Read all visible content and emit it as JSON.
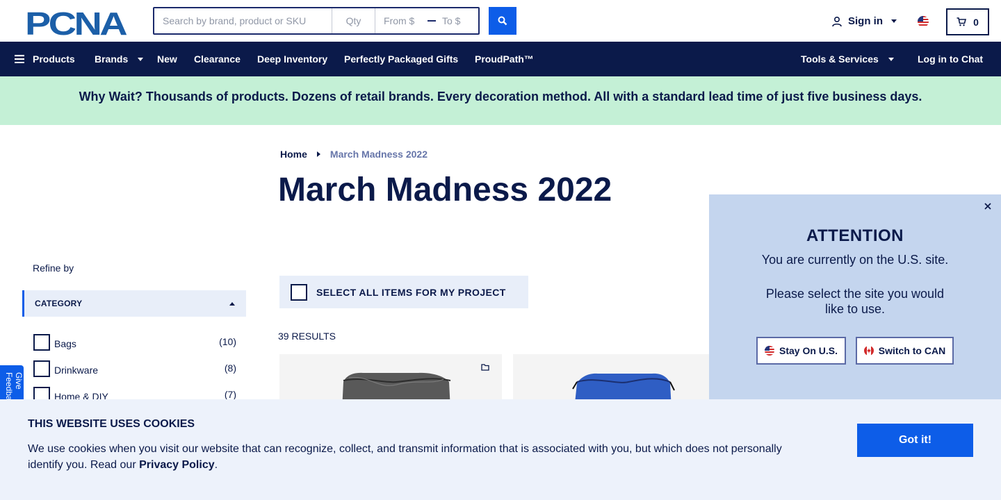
{
  "header": {
    "logo_text": "PCNA",
    "search_placeholder": "Search by brand, product or SKU",
    "qty_placeholder": "Qty",
    "from_placeholder": "From $",
    "to_placeholder": "To $",
    "signin_label": "Sign in",
    "cart_count": "0"
  },
  "nav": {
    "products": "Products",
    "brands": "Brands",
    "new": "New",
    "clearance": "Clearance",
    "deep_inventory": "Deep Inventory",
    "gifts": "Perfectly Packaged Gifts",
    "proudpath": "ProudPath™",
    "tools": "Tools & Services",
    "chat": "Log in to Chat"
  },
  "banner": {
    "text": "Why Wait? Thousands of products. Dozens of retail brands. Every decoration method. All with a standard lead time of just five business days."
  },
  "breadcrumb": {
    "home": "Home",
    "current": "March Madness 2022"
  },
  "page": {
    "title": "March Madness 2022",
    "select_all": "SELECT ALL ITEMS FOR MY PROJECT",
    "results": "39 RESULTS"
  },
  "sidebar": {
    "refine_label": "Refine by",
    "category_header": "CATEGORY",
    "categories": [
      {
        "label": "Bags",
        "count": "(10)"
      },
      {
        "label": "Drinkware",
        "count": "(8)"
      },
      {
        "label": "Home & DIY",
        "count": "(7)"
      }
    ],
    "feedback_label": "Give Feedback"
  },
  "popup": {
    "title": "ATTENTION",
    "message1": "You are currently on the U.S. site.",
    "message2": "Please select the site you would like to use.",
    "stay_label": "Stay On U.S.",
    "switch_label": "Switch to CAN"
  },
  "cookie": {
    "title": "THIS WEBSITE USES COOKIES",
    "text": "We use cookies when you visit our website that can recognize, collect, and transmit information that is associated with you, but which does not personally identify you. Read our ",
    "link": "Privacy Policy",
    "suffix": ".",
    "button": "Got it!"
  },
  "colors": {
    "navy": "#0b1a4a",
    "blue": "#0d5de8",
    "banner_green": "#c4f0d6",
    "popup_bg": "#c4d5ee",
    "cookie_bg": "#edf2fb"
  }
}
